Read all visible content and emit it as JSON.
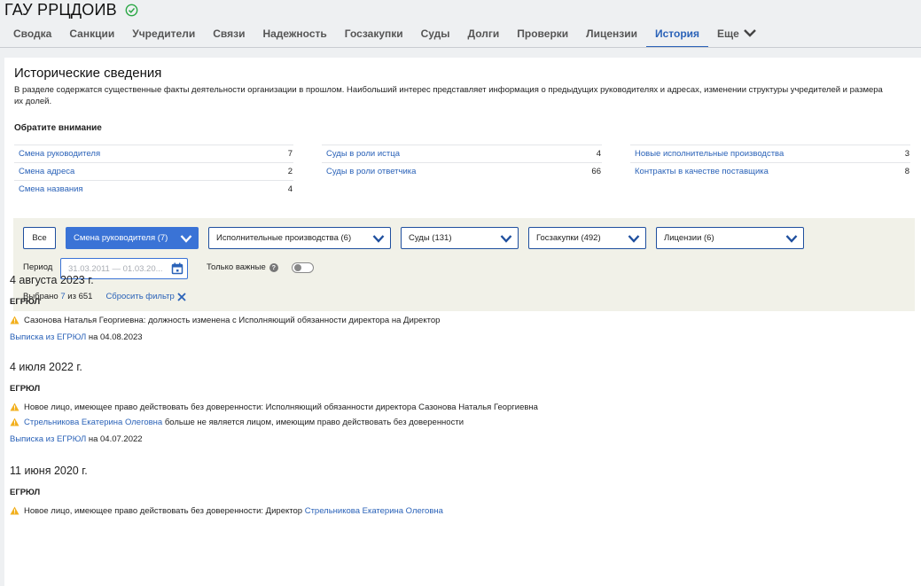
{
  "company": {
    "name": "ГАУ РРЦДОИВ",
    "status_icon": "check-circle-icon",
    "status_color": "#2aa745"
  },
  "tabs": [
    {
      "label": "Сводка"
    },
    {
      "label": "Санкции"
    },
    {
      "label": "Учредители"
    },
    {
      "label": "Связи"
    },
    {
      "label": "Надежность"
    },
    {
      "label": "Госзакупки"
    },
    {
      "label": "Суды"
    },
    {
      "label": "Долги"
    },
    {
      "label": "Проверки"
    },
    {
      "label": "Лицензии"
    },
    {
      "label": "История",
      "active": true
    },
    {
      "label": "Еще"
    }
  ],
  "section": {
    "title": "Исторические сведения",
    "description": "В разделе содержатся существенные факты деятельности организации в прошлом. Наибольший интерес представляет информация о предыдущих руководителях и адресах, изменении структуры учредителей и размера их долей.",
    "attention_title": "Обратите внимание"
  },
  "attention": {
    "col1": [
      {
        "label": "Смена руководителя",
        "count": "7"
      },
      {
        "label": "Смена адреса",
        "count": "2"
      },
      {
        "label": "Смена названия",
        "count": "4"
      }
    ],
    "col2": [
      {
        "label": "Суды в роли истца",
        "count": "4"
      },
      {
        "label": "Суды в роли ответчика",
        "count": "66"
      }
    ],
    "col3": [
      {
        "label": "Новые исполнительные производства",
        "count": "3"
      },
      {
        "label": "Контракты в качестве поставщика",
        "count": "8"
      }
    ]
  },
  "filters": {
    "all_label": "Все",
    "selects": [
      {
        "label": "Смена руководителя (7)",
        "active": true
      },
      {
        "label": "Исполнительные производства (6)"
      },
      {
        "label": "Суды (131)"
      },
      {
        "label": "Госзакупки (492)"
      },
      {
        "label": "Лицензии (6)"
      }
    ],
    "period_label": "Период",
    "period_placeholder": "31.03.2011 — 01.03.20...",
    "important_label": "Только важные",
    "important_on": false,
    "selected_prefix": "Выбрано",
    "selected_count": "7",
    "selected_suffix": "из 651",
    "reset_label": "Сбросить фильтр"
  },
  "events": [
    {
      "date": "4 августа 2023 г.",
      "source": "ЕГРЮЛ",
      "items": [
        {
          "text": "Сазонова Наталья Георгиевна: должность изменена с Исполняющий обязанности директора на Директор"
        }
      ],
      "extract_link": "Выписка из ЕГРЮЛ",
      "extract_date": "на 04.08.2023"
    },
    {
      "date": "4 июля 2022 г.",
      "source": "ЕГРЮЛ",
      "items": [
        {
          "text": "Новое лицо, имеющее право действовать без доверенности: Исполняющий обязанности директора Сазонова Наталья Георгиевна"
        },
        {
          "link": "Стрельникова Екатерина Олеговна",
          "text": " больше не является лицом, имеющим право действовать без доверенности"
        }
      ],
      "extract_link": "Выписка из ЕГРЮЛ",
      "extract_date": "на 04.07.2022"
    },
    {
      "date": "11 июня 2020 г.",
      "source": "ЕГРЮЛ",
      "items": [
        {
          "text": "Новое лицо, имеющее право действовать без доверенности: Директор ",
          "link_after": "Стрельникова Екатерина Олеговна"
        }
      ]
    }
  ],
  "colors": {
    "accent": "#2a62b8",
    "active_select": "#3a73d6",
    "warning": "#f2b01e",
    "filter_bg": "#f1f1e8"
  }
}
